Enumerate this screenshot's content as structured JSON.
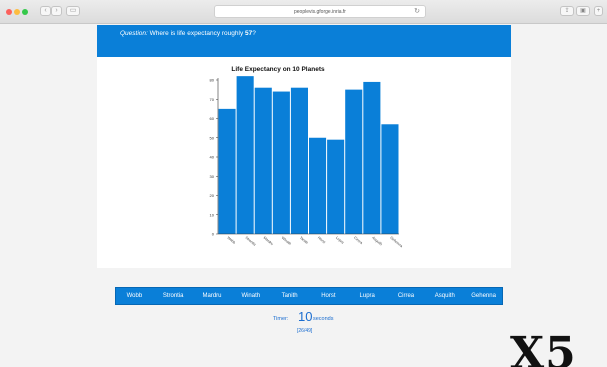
{
  "browser": {
    "url": "peoplevis.gforge.inria.fr"
  },
  "question": {
    "prefix": "Question:",
    "text": "Where is life expectancy roughly",
    "value": "57",
    "suffix": "?"
  },
  "chart_data": {
    "type": "bar",
    "title": "Life Expectancy on 10 Planets",
    "xlabel": "",
    "ylabel": "",
    "categories": [
      "Wobb",
      "Strontia",
      "Mardru",
      "Winath",
      "Tanith",
      "Horst",
      "Lupra",
      "Cirrea",
      "Asquith",
      "Gehenna"
    ],
    "values": [
      65,
      82,
      76,
      74,
      76,
      50,
      49,
      75,
      79,
      57
    ],
    "ylim": [
      0,
      80
    ],
    "yticks": [
      0,
      10,
      20,
      30,
      40,
      50,
      60,
      70,
      80
    ],
    "bar_color": "#0a7fd8",
    "grid": false
  },
  "answers": [
    "Wobb",
    "Strontia",
    "Mardru",
    "Winath",
    "Tanith",
    "Horst",
    "Lupra",
    "Cirrea",
    "Asquith",
    "Gehenna"
  ],
  "timer": {
    "label": "Timer:",
    "value": "10",
    "unit": "seconds"
  },
  "progress": "[26/49]",
  "watermark": "X5",
  "colors": {
    "accent": "#0a7fd8",
    "timer_text": "#1a6dd0"
  }
}
